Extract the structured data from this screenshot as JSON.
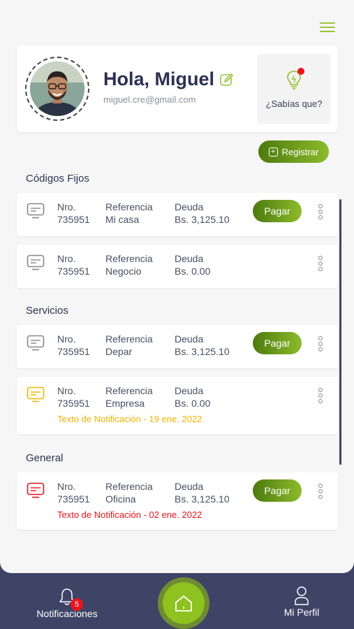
{
  "header": {
    "menu_icon": "hamburger-menu-icon"
  },
  "profile": {
    "greeting": "Hola, Miguel",
    "email": "miguel.cre@gmail.com",
    "tip_label": "¿Sabías que?"
  },
  "actions": {
    "register_label": "Registrar"
  },
  "sections": {
    "fixed_title": "Códigos Fijos",
    "services_title": "Servicios",
    "general_title": "General"
  },
  "cards": [
    {
      "nro_label": "Nro.",
      "nro": "735951",
      "ref_label": "Referencia",
      "ref": "Mi casa",
      "debt_label": "Deuda",
      "debt": "Bs. 3,125.10",
      "pay_label": "Pagar"
    },
    {
      "nro_label": "Nro.",
      "nro": "735951",
      "ref_label": "Referencia",
      "ref": "Negocio",
      "debt_label": "Deuda",
      "debt": "Bs. 0.00"
    },
    {
      "nro_label": "Nro.",
      "nro": "735951",
      "ref_label": "Referencia",
      "ref": "Depar",
      "debt_label": "Deuda",
      "debt": "Bs. 3,125.10",
      "pay_label": "Pagar"
    },
    {
      "nro_label": "Nro.",
      "nro": "735951",
      "ref_label": "Referencia",
      "ref": "Empresa",
      "debt_label": "Deuda",
      "debt": "Bs. 0.00",
      "notification": "Texto de Notificación - 19 ene. 2022",
      "notification_color": "#f0b400"
    },
    {
      "nro_label": "Nro.",
      "nro": "735951",
      "ref_label": "Referencia",
      "ref": "Oficina",
      "debt_label": "Deuda",
      "debt": "Bs. 3,125.10",
      "pay_label": "Pagar",
      "notification": "Texto de Notificación - 02 ene. 2022",
      "notification_color": "#e8141b"
    }
  ],
  "bottom_nav": {
    "notifications_label": "Notificaciones",
    "notifications_count": "5",
    "profile_label": "Mi Perfil"
  },
  "colors": {
    "accent": "#8dc21f",
    "nav_bg": "#3e4466",
    "warning": "#f0b400",
    "error": "#e8141b"
  }
}
